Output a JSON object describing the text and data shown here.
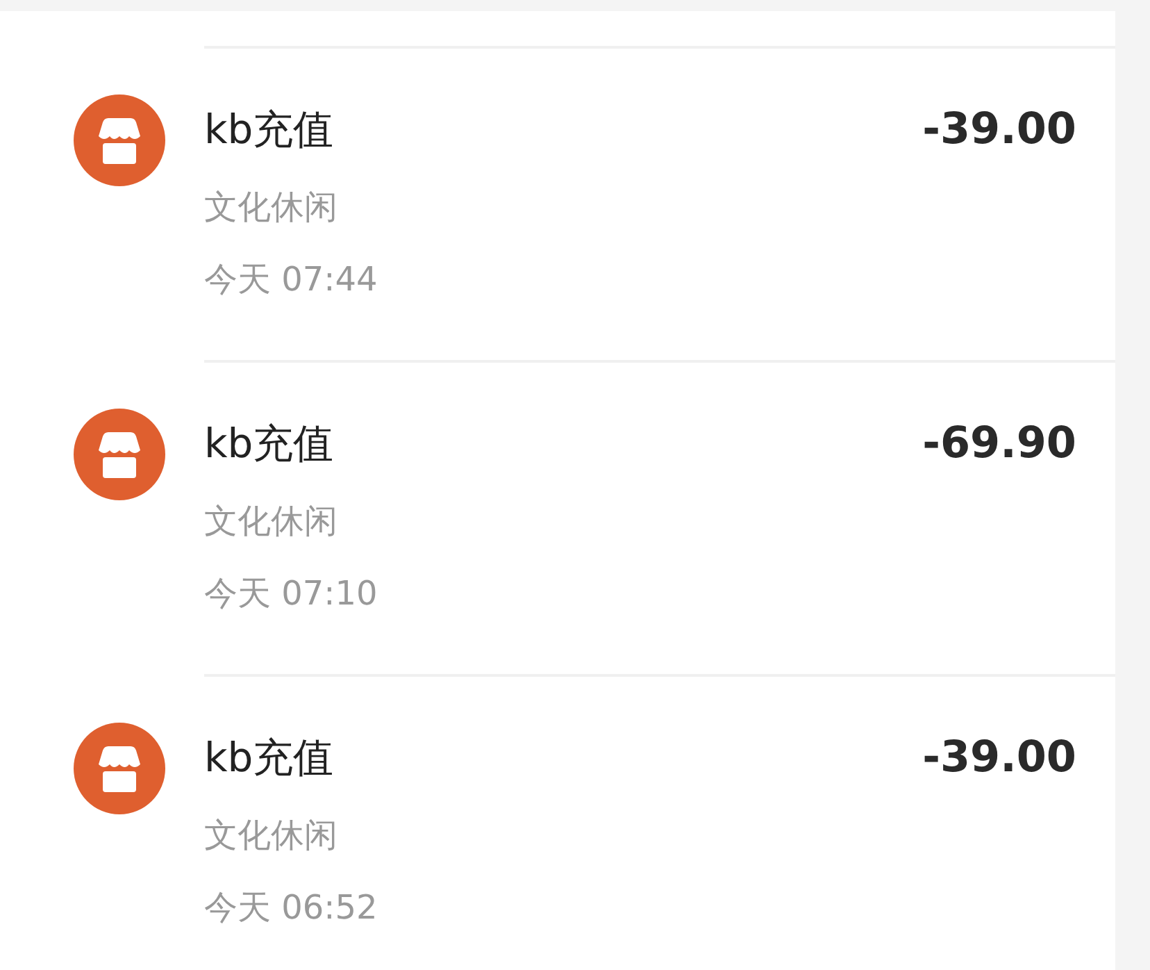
{
  "transactions": [
    {
      "title": "kb充值",
      "category": "文化休闲",
      "time": "今天 07:44",
      "amount": "-39.00"
    },
    {
      "title": "kb充值",
      "category": "文化休闲",
      "time": "今天 07:10",
      "amount": "-69.90"
    },
    {
      "title": "kb充值",
      "category": "文化休闲",
      "time": "今天 06:52",
      "amount": "-39.00"
    }
  ]
}
